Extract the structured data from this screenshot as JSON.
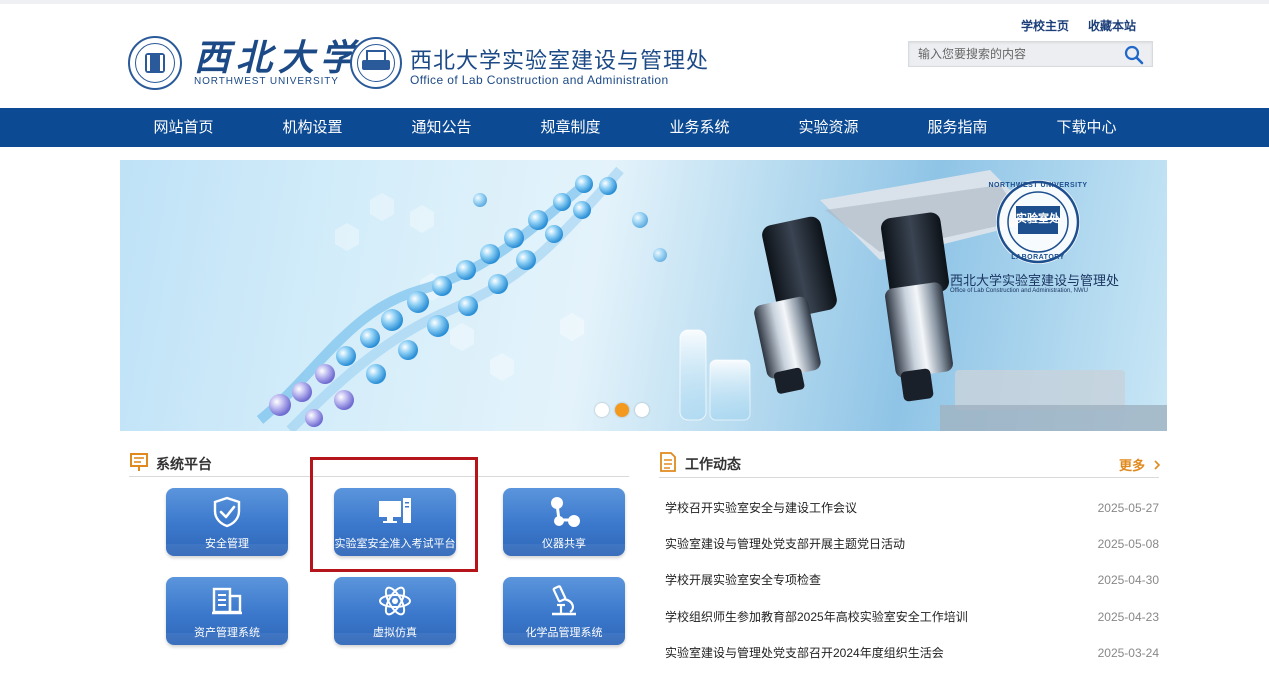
{
  "header": {
    "university_cn": "西北大学",
    "university_en": "NORTHWEST UNIVERSITY",
    "dept_cn": "西北大学实验室建设与管理处",
    "dept_en": "Office of Lab Construction and Administration",
    "links": {
      "home": "学校主页",
      "favorite": "收藏本站"
    },
    "search": {
      "placeholder": "输入您要搜索的内容",
      "value": ""
    }
  },
  "nav": {
    "items": [
      "网站首页",
      "机构设置",
      "通知公告",
      "规章制度",
      "业务系统",
      "实验资源",
      "服务指南",
      "下载中心"
    ]
  },
  "banner": {
    "seal_text": "实验室处",
    "seal_ring_top": "NORTHWEST UNIVERSITY",
    "seal_ring_bottom": "LABORATORY",
    "caption_cn": "西北大学实验室建设与管理处",
    "caption_en": "Office of Lab Construction and Administration, NWU",
    "slides": 3,
    "active_slide": 2
  },
  "systems": {
    "title": "系统平台",
    "tiles": [
      {
        "label": "安全管理",
        "icon": "shield-check-icon"
      },
      {
        "label": "实验室安全准入考试平台",
        "icon": "computer-monitor-icon",
        "highlighted": true
      },
      {
        "label": "仪器共享",
        "icon": "share-nodes-icon"
      },
      {
        "label": "资产管理系统",
        "icon": "building-icon"
      },
      {
        "label": "虚拟仿真",
        "icon": "atom-icon"
      },
      {
        "label": "化学品管理系统",
        "icon": "microscope-icon"
      }
    ]
  },
  "news": {
    "title": "工作动态",
    "more_label": "更多",
    "items": [
      {
        "title": "学校召开实验室安全与建设工作会议",
        "date": "2025-05-27"
      },
      {
        "title": "实验室建设与管理处党支部开展主题党日活动",
        "date": "2025-05-08"
      },
      {
        "title": "学校开展实验室安全专项检查",
        "date": "2025-04-30"
      },
      {
        "title": "学校组织师生参加教育部2025年高校实验室安全工作培训",
        "date": "2025-04-23"
      },
      {
        "title": "实验室建设与管理处党支部召开2024年度组织生活会",
        "date": "2025-03-24"
      }
    ]
  },
  "colors": {
    "nav_bg": "#0c4a93",
    "brand_text": "#1c4a86",
    "accent_orange": "#f39a1e",
    "highlight_box": "#b4141a",
    "tile_blue": "#3b78cc"
  }
}
